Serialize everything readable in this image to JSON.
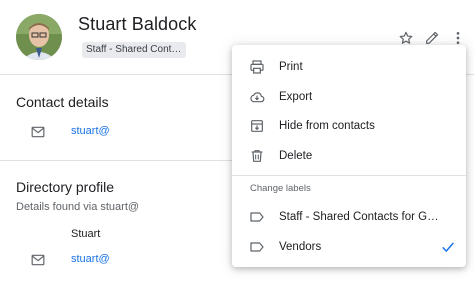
{
  "contact": {
    "name": "Stuart Baldock",
    "label_chip": "Staff - Shared Conta…"
  },
  "sections": {
    "contact_details": {
      "title": "Contact details",
      "email": "stuart@"
    },
    "directory_profile": {
      "title": "Directory profile",
      "subtitle": "Details found via stuart@",
      "first_name": "Stuart",
      "email": "stuart@"
    }
  },
  "menu": {
    "items": [
      {
        "label": "Print",
        "icon": "print-icon"
      },
      {
        "label": "Export",
        "icon": "cloud-download-icon"
      },
      {
        "label": "Hide from contacts",
        "icon": "archive-icon"
      },
      {
        "label": "Delete",
        "icon": "trash-icon"
      }
    ],
    "heading": "Change labels",
    "labels": [
      {
        "label": "Staff - Shared Contacts for G…",
        "icon": "label-icon",
        "checked": false
      },
      {
        "label": "Vendors",
        "icon": "label-icon",
        "checked": true
      }
    ]
  },
  "colors": {
    "accent": "#1a73e8",
    "text": "#202124",
    "muted": "#5f6368"
  }
}
